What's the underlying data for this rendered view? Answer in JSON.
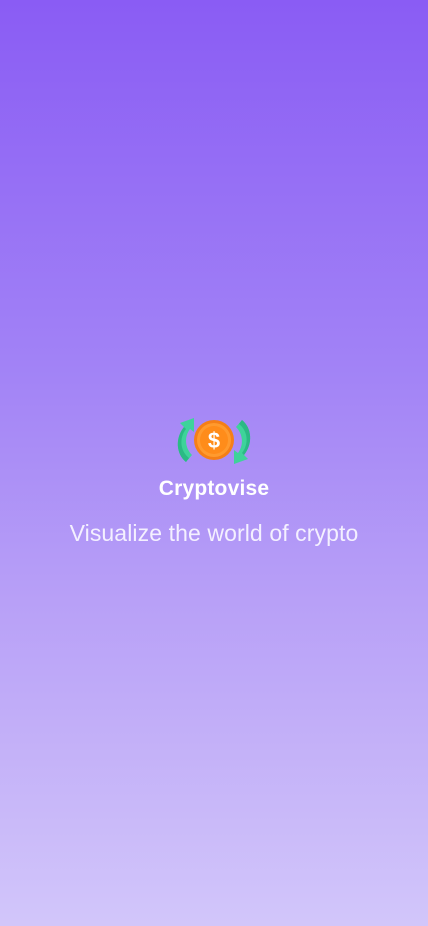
{
  "app": {
    "name": "Cryptovise",
    "tagline": "Visualize the world of crypto",
    "logo_icon": "coin-exchange-icon"
  },
  "colors": {
    "background_top": "#8a5cf4",
    "background_bottom": "#d2c6fa",
    "coin": "#f7941d",
    "coin_inner": "#ff9a2e",
    "arrows": "#3ed39a",
    "text": "#ffffff"
  }
}
